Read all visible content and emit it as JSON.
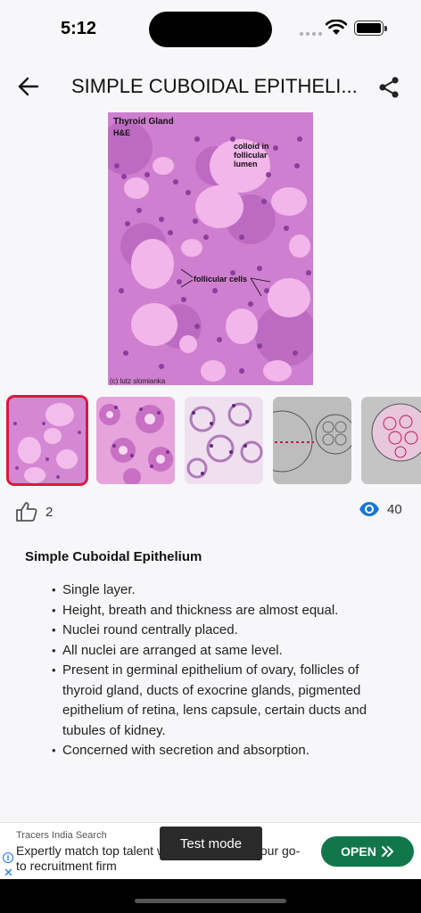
{
  "status_bar": {
    "time": "5:12"
  },
  "header": {
    "title": "SIMPLE CUBOIDAL EPITHELI..."
  },
  "hero_image": {
    "label_title": "Thyroid Gland",
    "label_stain": "H&E",
    "label_colloid": "colloid in follicular lumen",
    "label_cells": "follicular cells",
    "credit": "(c) lutz slomianka"
  },
  "thumbnails": [
    {
      "name": "thyroid-he",
      "active": true
    },
    {
      "name": "cuboid-section-2",
      "active": false
    },
    {
      "name": "cuboid-section-3",
      "active": false
    },
    {
      "name": "sketch-1",
      "active": false
    },
    {
      "name": "sketch-2",
      "active": false
    }
  ],
  "stats": {
    "likes": "2",
    "views": "40"
  },
  "content": {
    "heading": "Simple Cuboidal Epithelium",
    "points": [
      "Single layer.",
      "Height, breath and thickness are almost equal.",
      "Nuclei round centrally placed.",
      "All nuclei are arranged at same level.",
      "Present in germinal epithelium of ovary, follicles of thyroid gland, ducts of exocrine glands, pigmented epithelium of retina, lens capsule, certain ducts and tubules of kidney.",
      "Concerned with secretion and absorption."
    ]
  },
  "ad": {
    "source": "Tracers India Search",
    "text": "Expertly match top talent with companies - your go-to recruitment firm",
    "button": "OPEN",
    "test_badge": "Test mode"
  },
  "colors": {
    "accent": "#d81b3c",
    "ad_button": "#11774b",
    "eye": "#1976d2"
  }
}
